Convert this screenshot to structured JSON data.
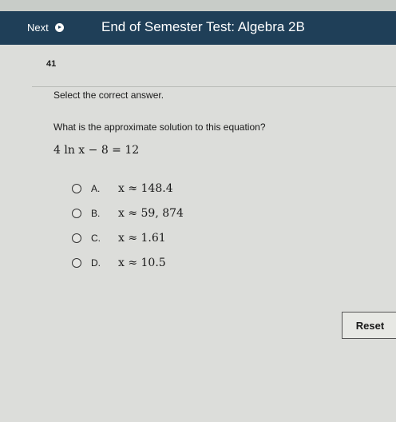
{
  "header": {
    "next_label": "Next",
    "title": "End of Semester Test: Algebra 2B"
  },
  "question": {
    "number": "41",
    "instruction": "Select the correct answer.",
    "prompt": "What is the approximate solution to this equation?",
    "equation": "4 ln x − 8 = 12",
    "choices": [
      {
        "letter": "A.",
        "value": "x ≈ 148.4"
      },
      {
        "letter": "B.",
        "value": "x ≈ 59, 874"
      },
      {
        "letter": "C.",
        "value": "x ≈ 1.61"
      },
      {
        "letter": "D.",
        "value": "x ≈ 10.5"
      }
    ]
  },
  "footer": {
    "reset_label": "Reset"
  },
  "colors": {
    "header_bg": "#1f3f58",
    "page_bg": "#dcddda"
  },
  "icons": {
    "next": "play-circle-icon",
    "choice": "radio-icon"
  }
}
